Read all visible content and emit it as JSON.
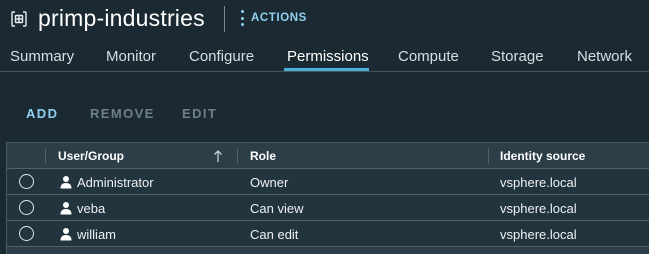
{
  "header": {
    "title": "primp-industries",
    "actions_label": "ACTIONS"
  },
  "tabs": [
    {
      "label": "Summary",
      "active": false
    },
    {
      "label": "Monitor",
      "active": false
    },
    {
      "label": "Configure",
      "active": false
    },
    {
      "label": "Permissions",
      "active": true
    },
    {
      "label": "Compute",
      "active": false
    },
    {
      "label": "Storage",
      "active": false
    },
    {
      "label": "Network",
      "active": false
    }
  ],
  "toolbar": {
    "add_label": "ADD",
    "remove_label": "REMOVE",
    "edit_label": "EDIT"
  },
  "grid": {
    "columns": [
      "User/Group",
      "Role",
      "Identity source"
    ],
    "sort": {
      "column": "User/Group",
      "direction": "ascending"
    },
    "rows": [
      {
        "user": "Administrator",
        "role": "Owner",
        "source": "vsphere.local"
      },
      {
        "user": "veba",
        "role": "Can view",
        "source": "vsphere.local"
      },
      {
        "user": "william",
        "role": "Can edit",
        "source": "vsphere.local"
      }
    ]
  },
  "colors": {
    "background": "#1b2a32",
    "accent": "#49afd9",
    "link": "#8fd0f2"
  },
  "icons": {
    "object": "datacenter-icon",
    "actions": "vertical-ellipsis-icon",
    "sort": "arrow-up-icon",
    "user": "user-icon"
  }
}
